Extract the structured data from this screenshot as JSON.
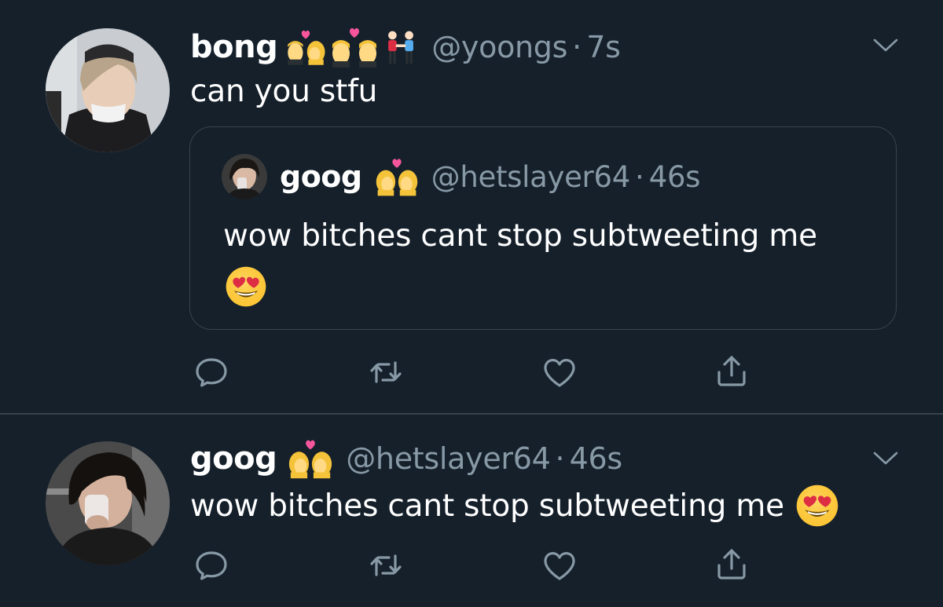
{
  "tweets": [
    {
      "author": {
        "display_name": "bong",
        "name_emojis": [
          "kiss-woman-man-icon",
          "couple-with-heart-man-man-icon",
          "men-holding-hands-icon"
        ],
        "handle": "@yoongs",
        "separator": "·",
        "time": "7s"
      },
      "text": "can you stfu",
      "quoted": {
        "display_name": "goog",
        "name_emojis": [
          "kiss-woman-woman-icon"
        ],
        "handle": "@hetslayer64",
        "separator": "·",
        "time": "46s",
        "text": "wow bitches cant stop subtweeting me",
        "trailing_emoji": "heart-eyes-emoji-icon"
      },
      "actions": [
        "reply-icon",
        "retweet-icon",
        "like-icon",
        "share-icon"
      ]
    },
    {
      "author": {
        "display_name": "goog",
        "name_emojis": [
          "kiss-woman-woman-icon"
        ],
        "handle": "@hetslayer64",
        "separator": "·",
        "time": "46s"
      },
      "text": "wow bitches cant stop subtweeting me",
      "trailing_emoji": "heart-eyes-emoji-icon",
      "actions": [
        "reply-icon",
        "retweet-icon",
        "like-icon",
        "share-icon"
      ]
    }
  ],
  "colors": {
    "background": "#15202b",
    "secondary_text": "#8899a6",
    "border": "#38444d",
    "primary_text": "#ffffff"
  }
}
